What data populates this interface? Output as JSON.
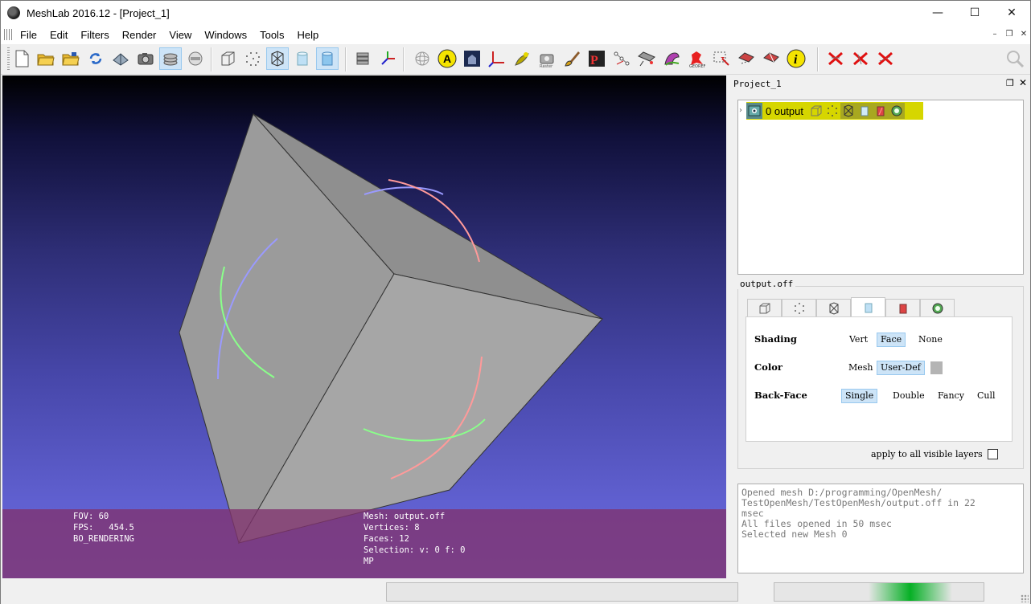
{
  "window": {
    "title": "MeshLab 2016.12 - [Project_1]",
    "minimize_glyph": "—",
    "maximize_glyph": "☐",
    "close_glyph": "✕"
  },
  "menu": [
    "File",
    "Edit",
    "Filters",
    "Render",
    "View",
    "Windows",
    "Tools",
    "Help"
  ],
  "toolbar": {
    "icons": [
      "new-project-icon",
      "open-project-icon",
      "import-mesh-icon",
      "reload-icon",
      "export-mesh-icon",
      "snapshot-icon",
      "layers-icon",
      "raster-icon",
      "bounding-box-icon",
      "points-icon",
      "wireframe-icon",
      "flat-icon",
      "smooth-icon",
      "decorate-icon",
      "axis-icon",
      "manipulator-icon",
      "annotation-icon",
      "raster-align-icon",
      "measure-icon",
      "align-icon",
      "paint-icon",
      "pickpoints-icon",
      "selection-icon",
      "connected-icon",
      "fix-icon",
      "georef-icon",
      "select-faces-icon",
      "select-vertices-icon",
      "info-icon",
      "delete-vert-icon",
      "delete-face-icon",
      "delete-all-icon",
      "search-icon"
    ]
  },
  "viewport": {
    "hud_left": [
      "FOV: 60",
      "FPS:   454.5",
      "BO_RENDERING"
    ],
    "hud_right": [
      "Mesh: output.off",
      "Vertices: 8",
      "Faces: 12",
      "Selection: v: 0 f: 0",
      "MP"
    ]
  },
  "panel": {
    "title": "Project_1",
    "layer": {
      "label": "0 output"
    },
    "group_title": "output.off",
    "shading": {
      "label": "Shading",
      "options": [
        "Vert",
        "Face",
        "None"
      ],
      "selected": "Face"
    },
    "color": {
      "label": "Color",
      "options": [
        "Mesh",
        "User-Def"
      ],
      "selected": "User-Def",
      "swatch": "#b4b4b4"
    },
    "backface": {
      "label": "Back-Face",
      "options": [
        "Single",
        "Double",
        "Fancy",
        "Cull"
      ],
      "selected": "Single"
    },
    "apply_label": "apply to all visible layers"
  },
  "log": [
    "Opened mesh D:/programming/OpenMesh/",
    "TestOpenMesh/TestOpenMesh/output.off in 22",
    "msec",
    "All files opened in 50 msec",
    "Selected new Mesh 0"
  ],
  "status": {
    "progress": 0.5
  },
  "colors": {
    "accent_select": "#cde4f7",
    "layer_highlight": "#d6d600",
    "hud_bg": "#80326e"
  }
}
